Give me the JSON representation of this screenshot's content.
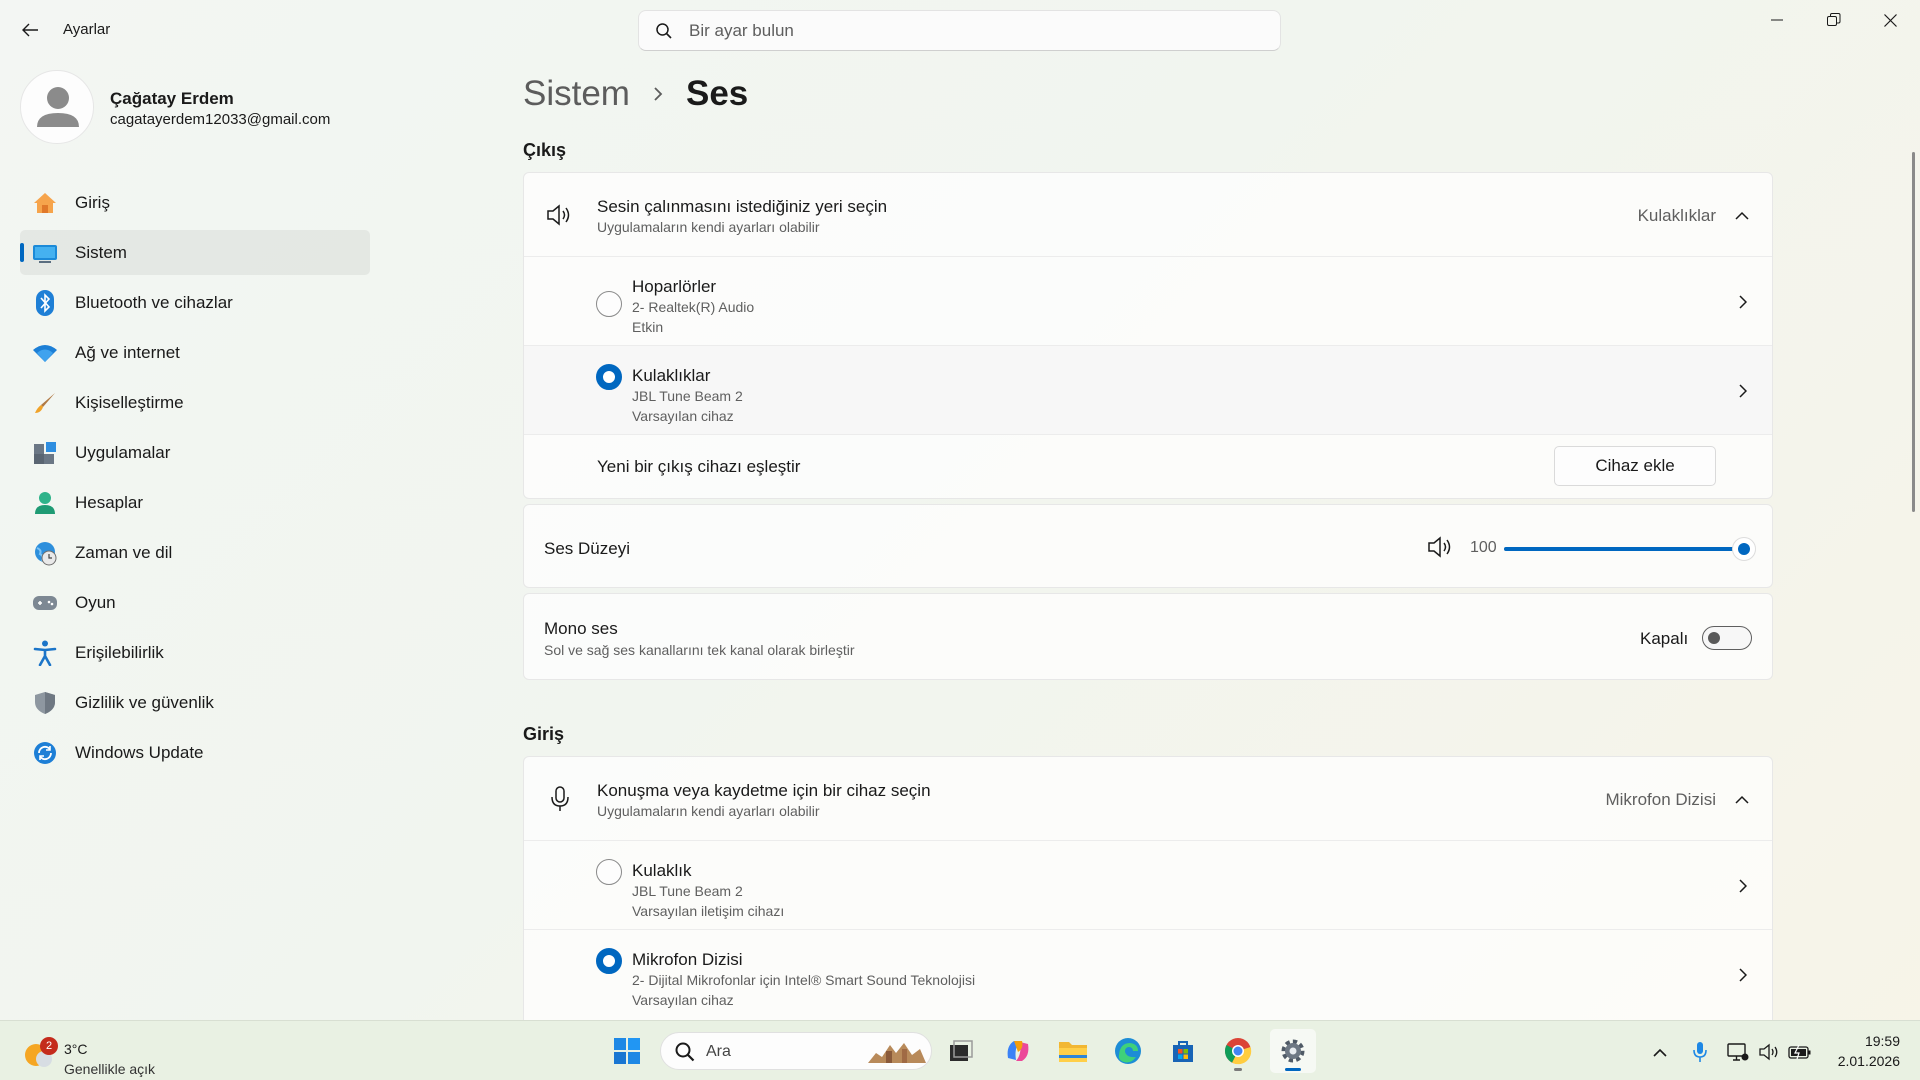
{
  "window": {
    "app_title": "Ayarlar",
    "search_placeholder": "Bir ayar bulun"
  },
  "profile": {
    "name": "Çağatay Erdem",
    "email": "cagatayerdem12033@gmail.com"
  },
  "sidebar": {
    "items": [
      {
        "label": "Giriş",
        "icon": "home-icon",
        "active": false
      },
      {
        "label": "Sistem",
        "icon": "system-icon",
        "active": true
      },
      {
        "label": "Bluetooth ve cihazlar",
        "icon": "bluetooth-icon",
        "active": false
      },
      {
        "label": "Ağ ve internet",
        "icon": "wifi-icon",
        "active": false
      },
      {
        "label": "Kişiselleştirme",
        "icon": "brush-icon",
        "active": false
      },
      {
        "label": "Uygulamalar",
        "icon": "apps-icon",
        "active": false
      },
      {
        "label": "Hesaplar",
        "icon": "account-icon",
        "active": false
      },
      {
        "label": "Zaman ve dil",
        "icon": "time-language-icon",
        "active": false
      },
      {
        "label": "Oyun",
        "icon": "gamepad-icon",
        "active": false
      },
      {
        "label": "Erişilebilirlik",
        "icon": "accessibility-icon",
        "active": false
      },
      {
        "label": "Gizlilik ve güvenlik",
        "icon": "shield-icon",
        "active": false
      },
      {
        "label": "Windows Update",
        "icon": "update-icon",
        "active": false
      }
    ]
  },
  "breadcrumb": {
    "parent": "Sistem",
    "current": "Ses"
  },
  "output": {
    "section_title": "Çıkış",
    "header_title": "Sesin çalınmasını istediğiniz yeri seçin",
    "header_sub": "Uygulamaların kendi ayarları olabilir",
    "selected": "Kulaklıklar",
    "devices": [
      {
        "name": "Hoparlörler",
        "detail": "2- Realtek(R) Audio",
        "status": "Etkin",
        "selected": false
      },
      {
        "name": "Kulaklıklar",
        "detail": "JBL Tune Beam 2",
        "status": "Varsayılan cihaz",
        "selected": true
      }
    ],
    "pair_label": "Yeni bir çıkış cihazı eşleştir",
    "pair_button": "Cihaz ekle"
  },
  "volume": {
    "label": "Ses Düzeyi",
    "value": "100",
    "level_percent": 100
  },
  "mono": {
    "title": "Mono ses",
    "sub": "Sol ve sağ ses kanallarını tek kanal olarak birleştir",
    "state_label": "Kapalı",
    "on": false
  },
  "input": {
    "section_title": "Giriş",
    "header_title": "Konuşma veya kaydetme için bir cihaz seçin",
    "header_sub": "Uygulamaların kendi ayarları olabilir",
    "selected": "Mikrofon Dizisi",
    "devices": [
      {
        "name": "Kulaklık",
        "detail": "JBL Tune Beam 2",
        "status": "Varsayılan iletişim cihazı",
        "selected": false
      },
      {
        "name": "Mikrofon Dizisi",
        "detail": "2- Dijital Mikrofonlar için Intel® Smart Sound Teknolojisi",
        "status": "Varsayılan cihaz",
        "selected": true
      }
    ]
  },
  "taskbar": {
    "weather_temp": "3°C",
    "weather_desc": "Genellikle açık",
    "weather_badge": "2",
    "search_label": "Ara",
    "apps": [
      "start-icon",
      "task-view-icon",
      "copilot-icon",
      "file-explorer-icon",
      "edge-icon",
      "store-icon",
      "chrome-icon",
      "settings-icon"
    ],
    "time": "19:59",
    "date": "2.01.2026"
  },
  "colors": {
    "accent": "#0067c0",
    "badge": "#c42b1c"
  }
}
